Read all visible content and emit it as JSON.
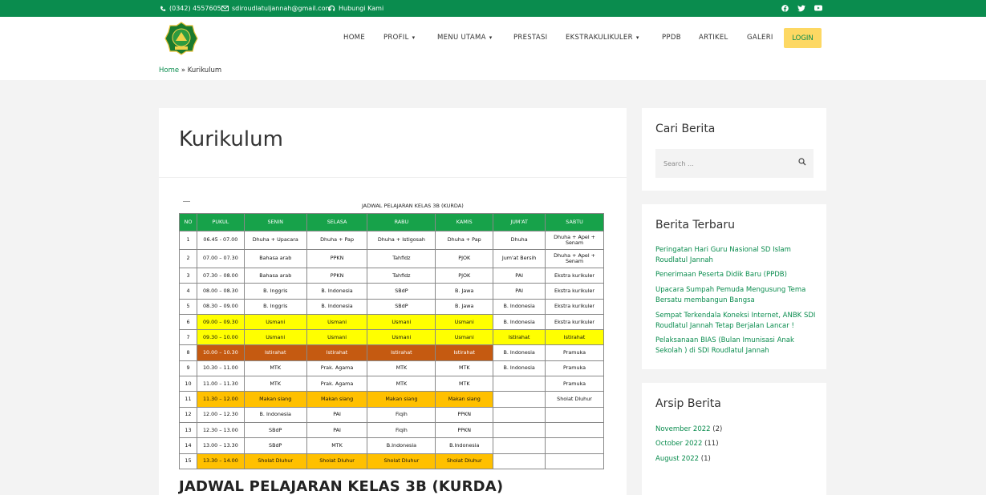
{
  "topbar": {
    "phone": "(0342) 4557605",
    "email": "sdiroudlatuljannah@gmail.com",
    "contact": "Hubungi Kami",
    "socials": [
      "facebook-icon",
      "twitter-icon",
      "youtube-icon"
    ]
  },
  "nav": {
    "items": [
      {
        "label": "HOME",
        "dropdown": false
      },
      {
        "label": "PROFIL",
        "dropdown": true
      },
      {
        "label": "MENU UTAMA",
        "dropdown": true
      },
      {
        "label": "PRESTASI",
        "dropdown": false
      },
      {
        "label": "EKSTRAKULIKULER",
        "dropdown": true
      },
      {
        "label": "PPDB",
        "dropdown": false
      },
      {
        "label": "ARTIKEL",
        "dropdown": false
      },
      {
        "label": "GALERI",
        "dropdown": false
      }
    ],
    "login": "LOGIN"
  },
  "breadcrumb": {
    "home": "Home",
    "sep": "»",
    "current": "Kurikulum"
  },
  "page": {
    "title": "Kurikulum",
    "table_caption": "JADWAL PELAJARAN KELAS 3B (KURDA)",
    "heading": "JADWAL PELAJARAN KELAS 3B (KURDA)"
  },
  "schedule": {
    "headers": [
      "NO",
      "PUKUL",
      "SENIN",
      "SELASA",
      "RABU",
      "KAMIS",
      "JUM'AT",
      "SABTU"
    ],
    "rows": [
      [
        "1",
        "06.45 - 07.00",
        "Dhuha + Upacara",
        "Dhuha + Pap",
        "Dhuha + Istigosah",
        "Dhuha + Pap",
        "Dhuha",
        "Dhuha + Apel + Senam"
      ],
      [
        "2",
        "07.00 – 07.30",
        "Bahasa arab",
        "PPKN",
        "Tahfidz",
        "PJOK",
        "Jum'at Bersih",
        "Dhuha + Apel + Senam"
      ],
      [
        "3",
        "07.30 – 08.00",
        "Bahasa arab",
        "PPKN",
        "Tahfidz",
        "PJOK",
        "PAI",
        "Ekstra kurikuler"
      ],
      [
        "4",
        "08.00 – 08.30",
        "B. Inggris",
        "B. Indonesia",
        "SBdP",
        "B. Jawa",
        "PAI",
        "Ekstra kurikuler"
      ],
      [
        "5",
        "08.30 – 09.00",
        "B. Inggris",
        "B. Indonesia",
        "SBdP",
        "B. Jawa",
        "B. Indonesia",
        "Ekstra kurikuler"
      ],
      [
        "6",
        "09.00 – 09.30",
        "Usmani",
        "Usmani",
        "Usmani",
        "Usmani",
        "B. Indonesia",
        "Ekstra kurikuler"
      ],
      [
        "7",
        "09.30 – 10.00",
        "Usmani",
        "Usmani",
        "Usmani",
        "Usmani",
        "Istirahat",
        "Istirahat"
      ],
      [
        "8",
        "10.00 – 10.30",
        "Istirahat",
        "Istirahat",
        "Istirahat",
        "Istirahat",
        "B. Indonesia",
        "Pramuka"
      ],
      [
        "9",
        "10.30 – 11.00",
        "MTK",
        "Prak. Agama",
        "MTK",
        "MTK",
        "B. Indonesia",
        "Pramuka"
      ],
      [
        "10",
        "11.00 – 11.30",
        "MTK",
        "Prak. Agama",
        "MTK",
        "MTK",
        "",
        "Pramuka"
      ],
      [
        "11",
        "11.30 – 12.00",
        "Makan siang",
        "Makan siang",
        "Makan siang",
        "Makan siang",
        "",
        "Sholat Dluhur"
      ],
      [
        "12",
        "12.00 – 12.30",
        "B. Indonesia",
        "PAI",
        "Fiqih",
        "PPKN",
        "",
        ""
      ],
      [
        "13",
        "12.30 – 13.00",
        "SBdP",
        "PAI",
        "Fiqih",
        "PPKN",
        "",
        ""
      ],
      [
        "14",
        "13.00 – 13.30",
        "SBdP",
        "MTK",
        "B.Indonesia",
        "B.Indonesia",
        "",
        ""
      ],
      [
        "15",
        "13.30 – 14.00",
        "Sholat Dluhur",
        "Sholat Dluhur",
        "Sholat Dluhur",
        "Sholat Dluhur",
        "",
        ""
      ]
    ],
    "colors": {
      "header": "#17a24a",
      "usmani": "#ffff00",
      "break": "#c55a11",
      "lunch": "#ffc000"
    }
  },
  "sidebar": {
    "search": {
      "title": "Cari Berita",
      "placeholder": "Search ..."
    },
    "recent": {
      "title": "Berita Terbaru",
      "items": [
        "Peringatan Hari Guru Nasional SD Islam Roudlatul Jannah",
        "Penerimaan Peserta Didik Baru (PPDB)",
        "Upacara Sumpah Pemuda Mengusung Tema Bersatu membangun Bangsa",
        "Sempat Terkendala Koneksi Internet, ANBK SDI Roudlatul Jannah Tetap Berjalan Lancar !",
        "Pelaksanaan BIAS (Bulan Imunisasi Anak Sekolah ) di SDI Roudlatul Jannah"
      ]
    },
    "archive": {
      "title": "Arsip Berita",
      "items": [
        {
          "label": "November 2022",
          "count": "(2)"
        },
        {
          "label": "October 2022",
          "count": "(11)"
        },
        {
          "label": "August 2022",
          "count": "(1)"
        }
      ]
    }
  },
  "colors": {
    "brand": "#0a8c4e",
    "login_bg": "#fdd863"
  }
}
